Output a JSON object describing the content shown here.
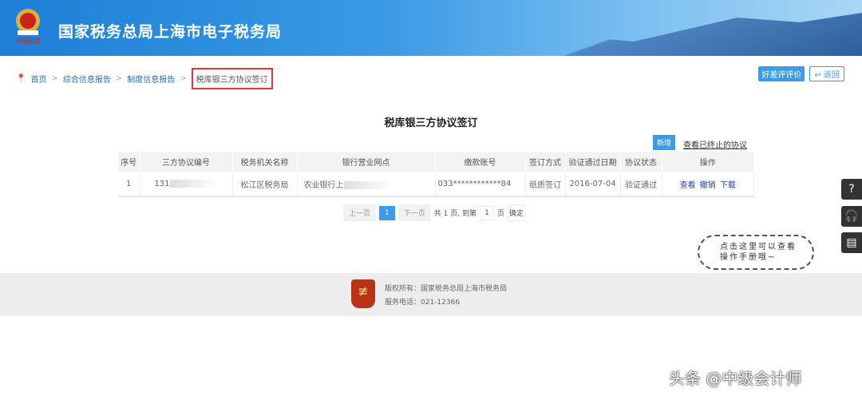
{
  "header": {
    "title": "国家税务总局上海市电子税务局"
  },
  "breadcrumb": {
    "items": [
      "首页",
      "综合信息报告",
      "制度信息报告"
    ],
    "current": "税库银三方协议签订"
  },
  "top_buttons": {
    "evaluate": "好差评评价",
    "back": "返回"
  },
  "page_title": "税库银三方协议签订",
  "actions": {
    "new": "新增",
    "view_terminated": "查看已终止的协议"
  },
  "table": {
    "columns": [
      "序号",
      "三方协议编号",
      "税务机关名称",
      "银行营业网点",
      "缴款账号",
      "签订方式",
      "验证通过日期",
      "协议状态",
      "操作"
    ],
    "rows": [
      {
        "index": "1",
        "agreement_no": "131",
        "tax_office": "松江区税务局",
        "bank_branch": "农业银行上",
        "account": "033************84",
        "sign_method": "纸质签订",
        "verify_date": "2016-07-04",
        "status": "验证通过",
        "ops": [
          "查看",
          "撤销",
          "下载"
        ]
      }
    ]
  },
  "pager": {
    "prev": "上一页",
    "current": "1",
    "next": "下一页",
    "total": "共 1 页, 到第",
    "input": "1",
    "page_unit": "页",
    "confirm": "确定"
  },
  "help_bubble": {
    "line1": "点击这里可以查看",
    "line2": "操作手册哦~"
  },
  "footer": {
    "copyright": "版权所有：国家税务总局上海市税务局",
    "phone": "服务电话：021-12366"
  },
  "watermark": "头条 @中级会计师"
}
